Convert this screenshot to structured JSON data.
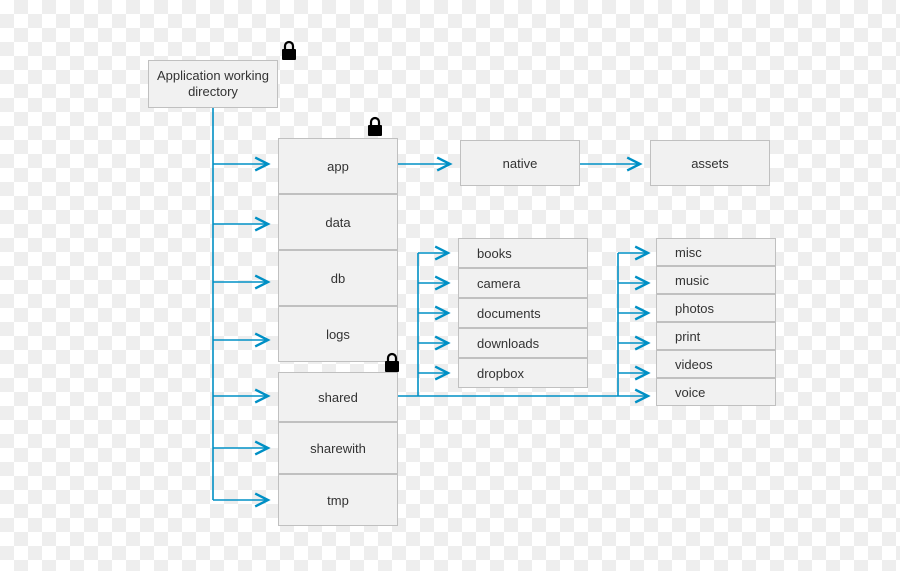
{
  "root": {
    "label": "Application working directory"
  },
  "level1": {
    "app": "app",
    "data": "data",
    "db": "db",
    "logs": "logs",
    "shared": "shared",
    "sharewith": "sharewith",
    "tmp": "tmp"
  },
  "app_children": {
    "native": "native",
    "assets": "assets"
  },
  "shared_children": {
    "books": "books",
    "camera": "camera",
    "documents": "documents",
    "downloads": "downloads",
    "dropbox": "dropbox"
  },
  "shared_children2": {
    "misc": "misc",
    "music": "music",
    "photos": "photos",
    "print": "print",
    "videos": "videos",
    "voice": "voice"
  },
  "locks": {
    "root": "lock-icon",
    "app": "lock-icon",
    "shared": "lock-icon"
  },
  "colors": {
    "arrow": "#0090c5",
    "boxFill": "#f1f1f1",
    "boxBorder": "#c0c0c0"
  }
}
